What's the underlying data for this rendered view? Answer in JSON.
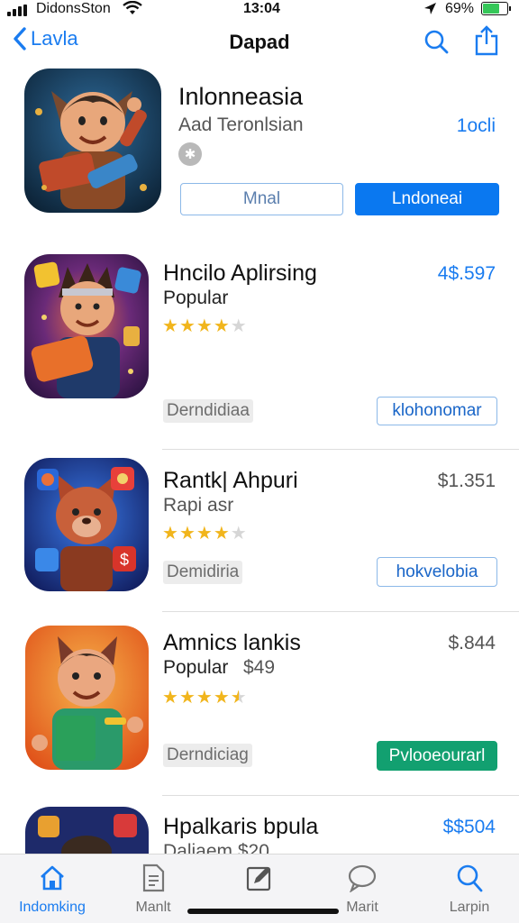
{
  "status_bar": {
    "carrier": "DidonsSton",
    "time": "13:04",
    "battery": "69%",
    "battery_level": 0.69
  },
  "nav": {
    "back_label": "Lavla",
    "title": "Dapad"
  },
  "apps": [
    {
      "name": "Inlonneasia",
      "subtitle": "Aad Teronlsian",
      "price": "1ocli",
      "secondary_button": "Mnal",
      "primary_button": "Lndoneai",
      "icon": "app-icon-hero-with-bag"
    },
    {
      "name": "Hncilo Aplirsing",
      "subtitle": "Popular",
      "price": "4$.597",
      "rating": 4,
      "tag": "Derndidiaa",
      "button": "klohonomar",
      "icon": "app-icon-hero-headband"
    },
    {
      "name": "Rantk| Ahpuri",
      "subtitle": "Rapi asr",
      "price": "$1.351",
      "rating": 4,
      "tag": "Demidiria",
      "button": "hokvelobia",
      "icon": "app-icon-bear"
    },
    {
      "name": "Amnics lankis",
      "subtitle": "Popular",
      "subtitle_extra": "$49",
      "price": "$.844",
      "rating": 4.5,
      "tag": "Derndiciag",
      "button": "Pvlooeourarl",
      "icon": "app-icon-hero-green-book"
    },
    {
      "name": "Hpalkaris bpula",
      "subtitle": "Daliaem $20",
      "price": "$$504",
      "icon": "app-icon-hero-dark"
    }
  ],
  "tabbar": [
    {
      "label": "Indomking",
      "icon": "home-icon",
      "active": true
    },
    {
      "label": "Manlt",
      "icon": "document-icon",
      "active": false
    },
    {
      "label": "",
      "icon": "edit-icon",
      "active": false
    },
    {
      "label": "Marit",
      "icon": "chat-bubble-icon",
      "active": false
    },
    {
      "label": "Larpin",
      "icon": "search-icon",
      "active": false
    }
  ],
  "colors": {
    "accent": "#1a7cf0",
    "primary_button": "#0a78f0",
    "green_button": "#12a070",
    "star": "#f1b51c"
  }
}
